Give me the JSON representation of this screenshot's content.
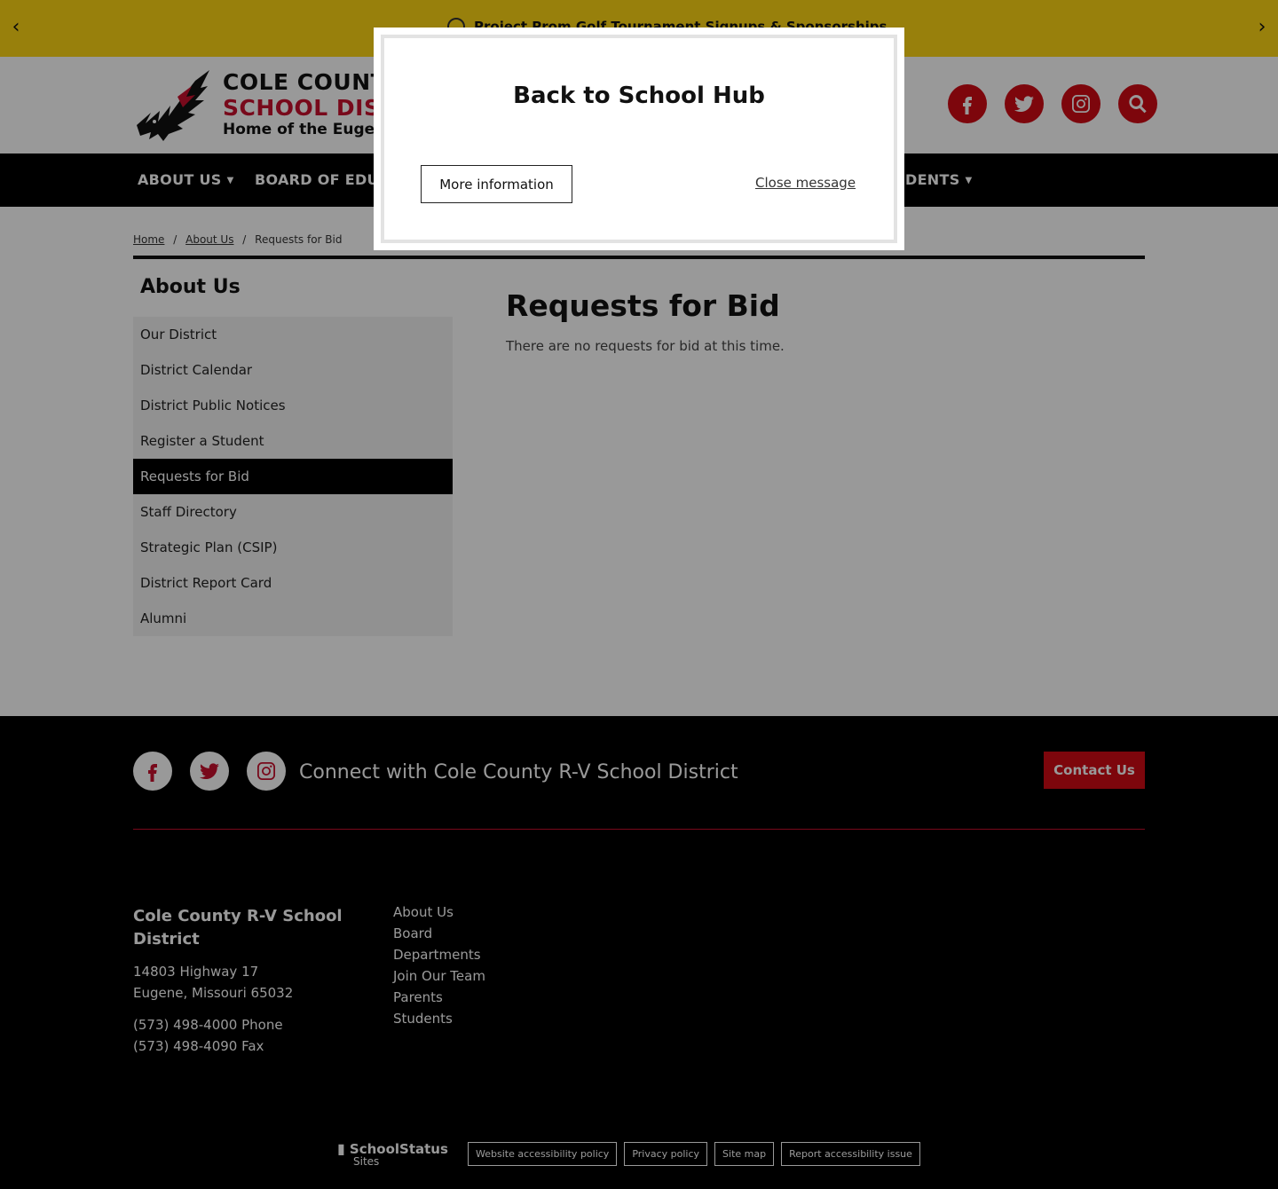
{
  "alert": {
    "text": "Project Prom Golf Tournament Signups & Sponsorships",
    "prev": "‹",
    "next": "›"
  },
  "header": {
    "logo_line1": "COLE COUNTY",
    "logo_line2": "SCHOOL DIST",
    "logo_line3": "Home of the Eugene",
    "icons": [
      "facebook-icon",
      "twitter-icon",
      "instagram-icon",
      "search-icon"
    ],
    "icon_bg": "#d00a14"
  },
  "nav": {
    "items": [
      {
        "label": "ABOUT US"
      },
      {
        "label": "BOARD OF EDUCA"
      },
      {
        "label": "DENTS"
      }
    ]
  },
  "breadcrumb": {
    "home": "Home",
    "sep": "/",
    "about": "About Us",
    "current": "Requests for Bid"
  },
  "sidebar": {
    "title": "About Us",
    "items": [
      {
        "label": "Our District"
      },
      {
        "label": "District Calendar"
      },
      {
        "label": "District Public Notices"
      },
      {
        "label": "Register a Student"
      },
      {
        "label": "Requests for Bid"
      },
      {
        "label": "Staff Directory"
      },
      {
        "label": "Strategic Plan (CSIP)"
      },
      {
        "label": "District Report Card"
      },
      {
        "label": "Alumni"
      }
    ],
    "active_index": 4
  },
  "content": {
    "title": "Requests for Bid",
    "text": "There are no requests for bid at this time."
  },
  "footer": {
    "connect": "Connect with Cole County R-V School District",
    "contact_label": "Contact Us",
    "org": "Cole County R-V School District",
    "address1": "14803 Highway 17",
    "address2": "Eugene, Missouri 65032",
    "phone": "(573) 498-4000 Phone",
    "fax": "(573) 498-4090 Fax",
    "links": [
      {
        "label": "About Us"
      },
      {
        "label": "Board"
      },
      {
        "label": "Departments"
      },
      {
        "label": "Join Our Team"
      },
      {
        "label": "Parents"
      },
      {
        "label": "Students"
      }
    ],
    "brand_line1": "SchoolStatus",
    "brand_line2": "Sites",
    "policy_links": [
      {
        "label": "Website accessibility policy"
      },
      {
        "label": "Privacy policy"
      },
      {
        "label": "Site map"
      },
      {
        "label": "Report accessibility issue"
      }
    ]
  },
  "modal": {
    "title": "Back to School Hub",
    "more_label": "More information",
    "close_label": "Close message"
  }
}
